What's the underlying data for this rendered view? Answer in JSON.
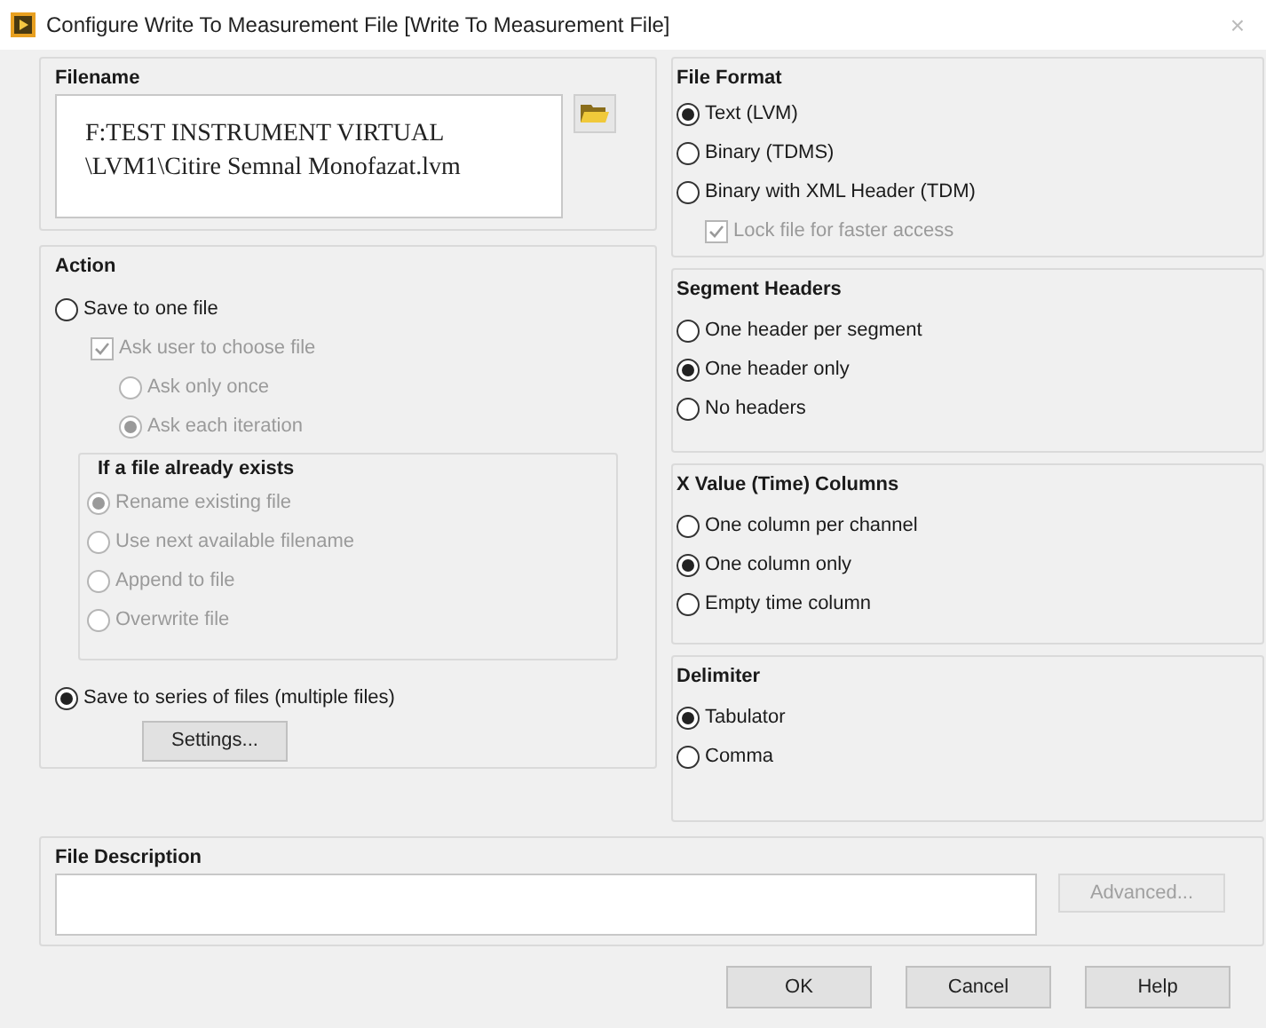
{
  "window": {
    "title": "Configure Write To Measurement File [Write To Measurement File]",
    "close": "×"
  },
  "filename": {
    "label": "Filename",
    "lines": [
      "F:TEST INSTRUMENT VIRTUAL",
      "\\LVM1\\Citire Semnal Monofazat.lvm"
    ]
  },
  "action": {
    "label": "Action",
    "save_one": {
      "label": "Save to one file",
      "selected": false,
      "disabled": false
    },
    "ask_user": {
      "label": "Ask user to choose file",
      "checked": true,
      "disabled": true
    },
    "ask_options": [
      {
        "label": "Ask only once",
        "selected": false,
        "disabled": true
      },
      {
        "label": "Ask each iteration",
        "selected": true,
        "disabled": true
      }
    ],
    "exists": {
      "label": "If a file already exists",
      "options": [
        {
          "label": "Rename existing file",
          "selected": true,
          "disabled": true
        },
        {
          "label": "Use next available filename",
          "selected": false,
          "disabled": true
        },
        {
          "label": "Append to file",
          "selected": false,
          "disabled": true
        },
        {
          "label": "Overwrite file",
          "selected": false,
          "disabled": true
        }
      ]
    },
    "save_series": {
      "label": "Save to series of files (multiple files)",
      "selected": true,
      "disabled": false
    },
    "settings_button": "Settings..."
  },
  "right_groups": [
    {
      "label": "File Format",
      "options": [
        {
          "label": "Text (LVM)",
          "selected": true,
          "disabled": false
        },
        {
          "label": "Binary (TDMS)",
          "selected": false,
          "disabled": false
        },
        {
          "label": "Binary with XML Header (TDM)",
          "selected": false,
          "disabled": false
        }
      ],
      "checkbox": {
        "label": "Lock file for faster access",
        "checked": true,
        "disabled": true
      }
    },
    {
      "label": "Segment Headers",
      "options": [
        {
          "label": "One header per segment",
          "selected": false,
          "disabled": false
        },
        {
          "label": "One header only",
          "selected": true,
          "disabled": false
        },
        {
          "label": "No headers",
          "selected": false,
          "disabled": false
        }
      ]
    },
    {
      "label": "X Value (Time) Columns",
      "options": [
        {
          "label": "One column per channel",
          "selected": false,
          "disabled": false
        },
        {
          "label": "One column only",
          "selected": true,
          "disabled": false
        },
        {
          "label": "Empty time column",
          "selected": false,
          "disabled": false
        }
      ]
    },
    {
      "label": "Delimiter",
      "options": [
        {
          "label": "Tabulator",
          "selected": true,
          "disabled": false
        },
        {
          "label": "Comma",
          "selected": false,
          "disabled": false
        }
      ]
    }
  ],
  "file_description": {
    "label": "File Description",
    "advanced_button": "Advanced...",
    "advanced_disabled": true
  },
  "buttons": [
    "OK",
    "Cancel",
    "Help"
  ]
}
